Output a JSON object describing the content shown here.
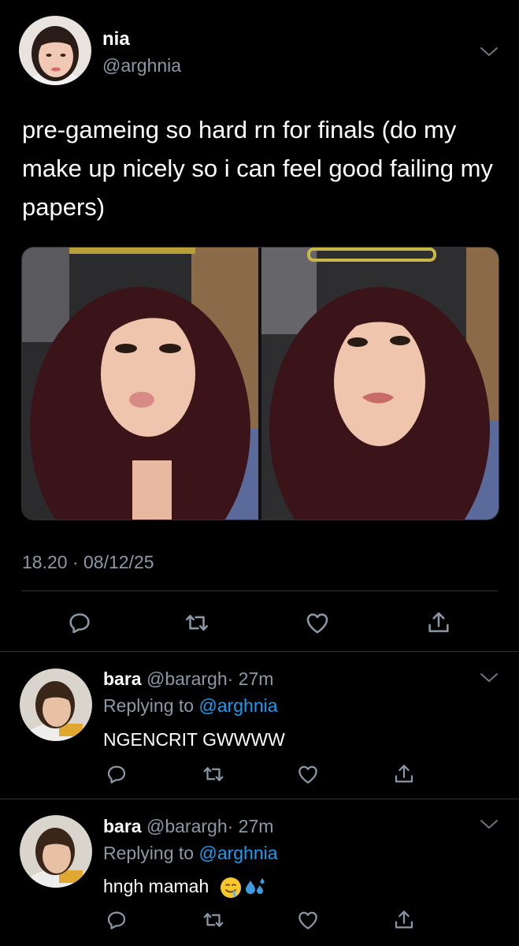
{
  "tweet": {
    "display_name": "nia",
    "handle": "@arghnia",
    "text": "pre-gameing so hard rn for finals (do my make up nicely so i can feel good failing my papers)",
    "timestamp": "18.20 · 08/12/25",
    "actions": [
      "reply-icon",
      "retweet-icon",
      "like-icon",
      "share-icon"
    ]
  },
  "replies": [
    {
      "display_name": "bara",
      "handle": "@barargh",
      "time": "· 27m",
      "replying_label": "Replying to",
      "replying_to": "@arghnia",
      "text": "NGENCRIT GWWWW",
      "emoji": []
    },
    {
      "display_name": "bara",
      "handle": "@barargh",
      "time": "· 27m",
      "replying_label": "Replying to",
      "replying_to": "@arghnia",
      "text": "hngh mamah",
      "emoji": [
        "drooling-face-emoji",
        "sweat-droplets-emoji"
      ]
    }
  ],
  "colors": {
    "background": "#000000",
    "secondary_text": "#8b98a5",
    "link": "#1d9bf0",
    "divider": "#2f3336"
  }
}
